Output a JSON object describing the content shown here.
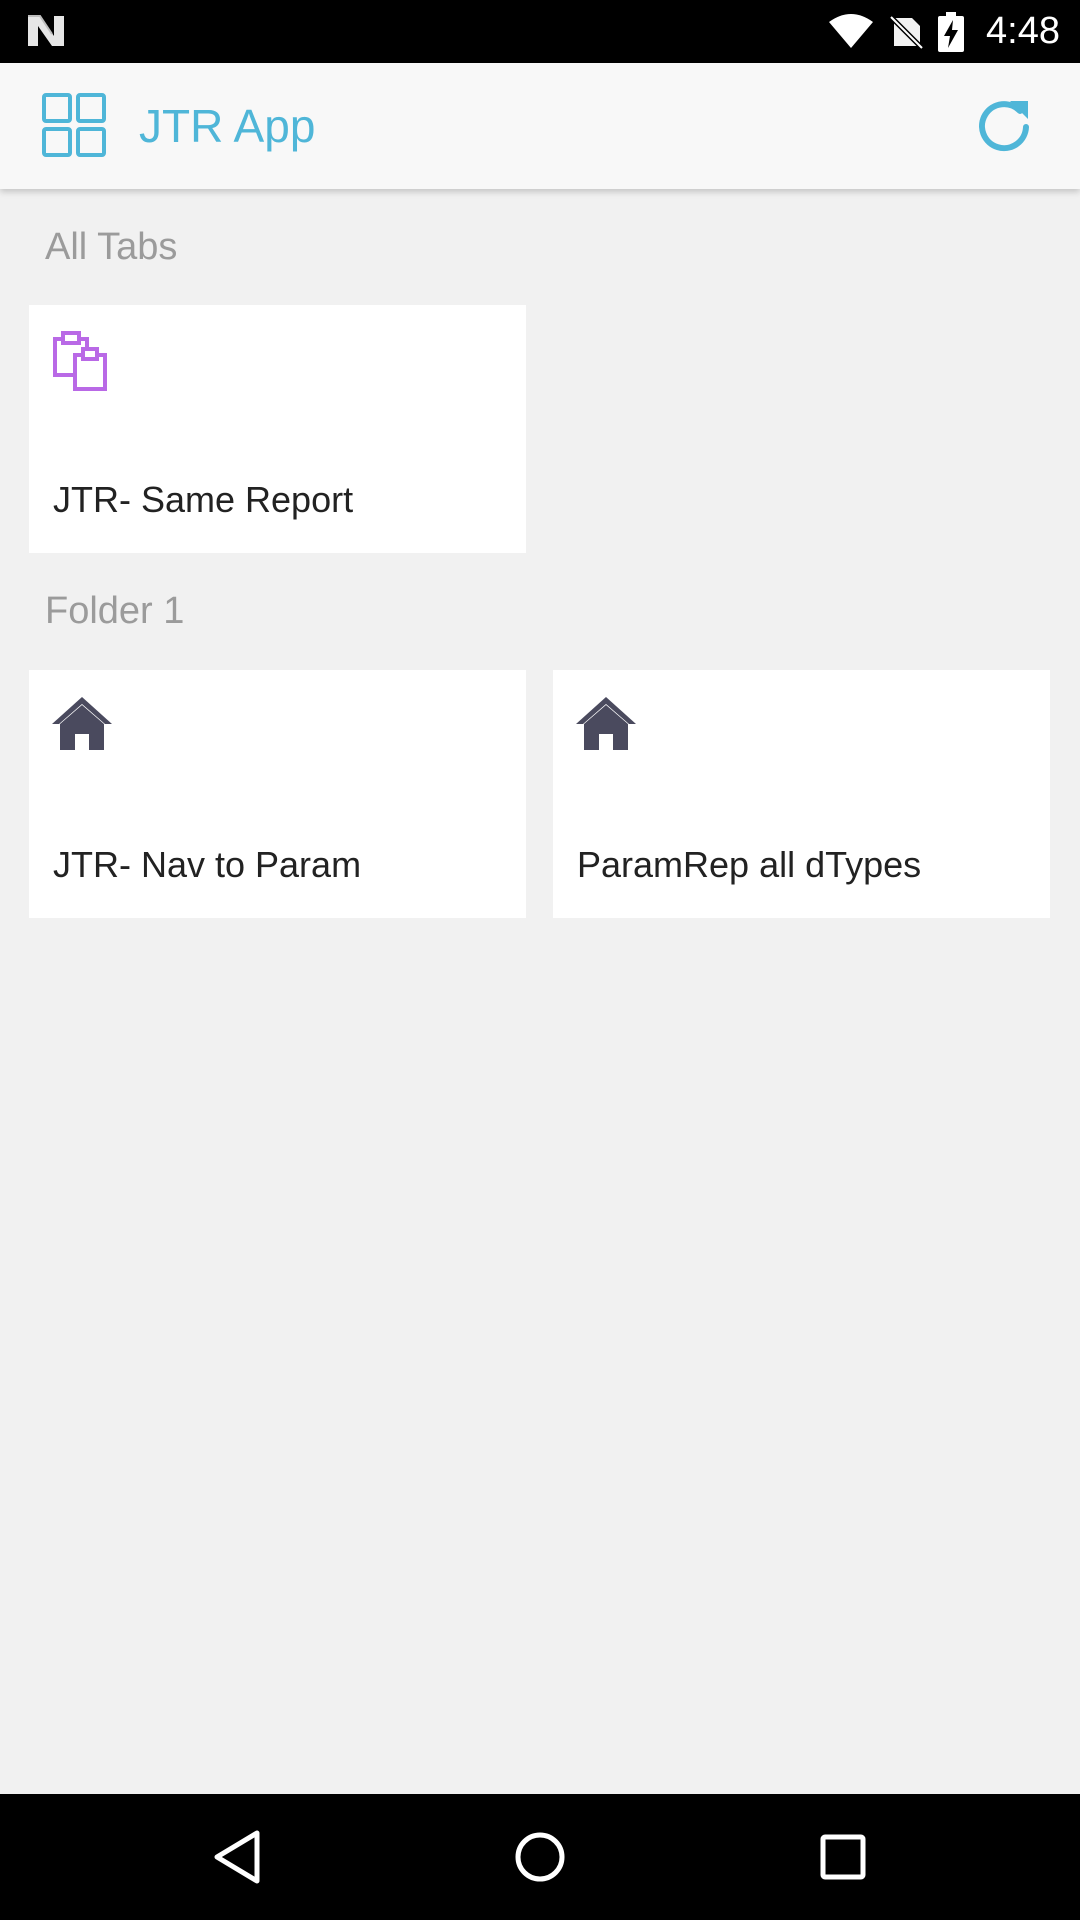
{
  "status_bar": {
    "time": "4:48",
    "icons": [
      "n-logo-icon",
      "wifi-icon",
      "no-sim-icon",
      "battery-charging-icon"
    ]
  },
  "app_bar": {
    "title": "JTR App",
    "left_icon": "grid-icon",
    "right_icon": "refresh-icon",
    "accent_color": "#4fb6d8"
  },
  "sections": [
    {
      "label": "All Tabs",
      "tiles": [
        {
          "label": "JTR- Same Report",
          "icon": "clipboard-icon",
          "icon_color": "#b969e6"
        }
      ]
    },
    {
      "label": "Folder 1",
      "tiles": [
        {
          "label": "JTR- Nav to Param",
          "icon": "home-icon",
          "icon_color": "#4a4a5e"
        },
        {
          "label": "ParamRep all dTypes",
          "icon": "home-icon",
          "icon_color": "#4a4a5e"
        }
      ]
    }
  ],
  "nav_bar": {
    "buttons": [
      "back-icon",
      "home-circle-icon",
      "recents-icon"
    ]
  }
}
